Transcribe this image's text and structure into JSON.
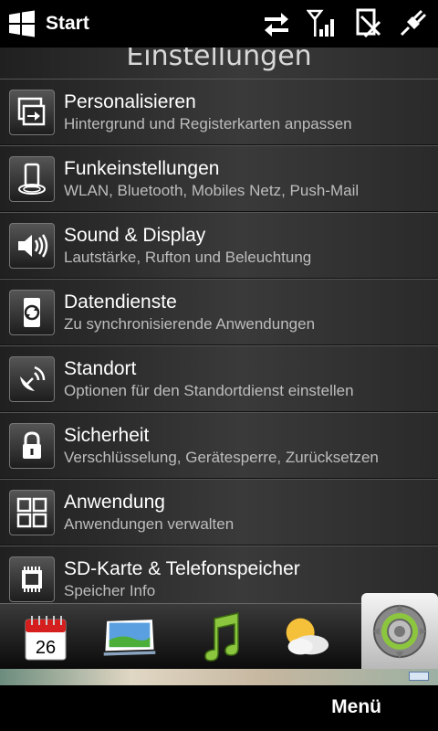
{
  "statusbar": {
    "start_label": "Start",
    "icons": [
      "data-sync-icon",
      "signal-strength-icon",
      "notification-icon",
      "usb-power-icon"
    ]
  },
  "page": {
    "title": "Einstellungen"
  },
  "items": [
    {
      "title": "Personalisieren",
      "subtitle": "Hintergrund und Registerkarten anpassen",
      "icon": "personalize-icon"
    },
    {
      "title": "Funkeinstellungen",
      "subtitle": "WLAN, Bluetooth, Mobiles Netz, Push-Mail",
      "icon": "wireless-icon"
    },
    {
      "title": "Sound & Display",
      "subtitle": "Lautstärke, Rufton und Beleuchtung",
      "icon": "speaker-icon"
    },
    {
      "title": "Datendienste",
      "subtitle": "Zu synchronisierende Anwendungen",
      "icon": "sync-icon"
    },
    {
      "title": "Standort",
      "subtitle": "Optionen für den Standortdienst einstellen",
      "icon": "satellite-icon"
    },
    {
      "title": "Sicherheit",
      "subtitle": "Verschlüsselung, Gerätesperre, Zurücksetzen",
      "icon": "lock-icon"
    },
    {
      "title": "Anwendung",
      "subtitle": "Anwendungen verwalten",
      "icon": "apps-grid-icon"
    },
    {
      "title": "SD-Karte & Telefonspeicher",
      "subtitle": "Speicher Info",
      "icon": "memory-chip-icon"
    }
  ],
  "dock": {
    "calendar_date": "26",
    "tabs": [
      "calendar-icon",
      "photos-icon",
      "music-icon",
      "weather-icon",
      "settings-gear-icon"
    ],
    "active_tab": "settings-gear-icon"
  },
  "softkeys": {
    "right": "Menü"
  },
  "colors": {
    "accent_green": "#8cc63f",
    "text_secondary": "#bdbdbd"
  }
}
